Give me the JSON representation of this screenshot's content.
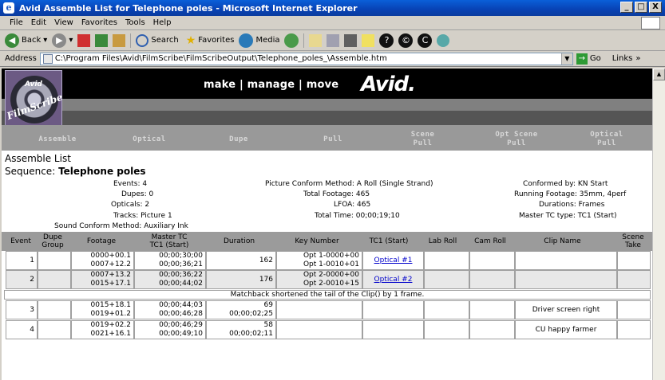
{
  "window": {
    "title": "Avid Assemble List for Telephone poles - Microsoft Internet Explorer",
    "minimize": "_",
    "restore": "□",
    "close": "X"
  },
  "menu": [
    "File",
    "Edit",
    "View",
    "Favorites",
    "Tools",
    "Help"
  ],
  "toolbar": {
    "back": "Back",
    "search": "Search",
    "favorites": "Favorites",
    "media": "Media"
  },
  "address": {
    "label": "Address",
    "url": "C:\\Program Files\\Avid\\FilmScribe\\FilmScribeOutput\\Telephone_poles_\\Assemble.htm",
    "go": "Go",
    "links": "Links"
  },
  "banner": {
    "nav": "make | manage | move",
    "brand": "Avid.",
    "logo_small": "Avid",
    "logo_name": "FilmScribe"
  },
  "tabs": [
    {
      "l1": "Assemble",
      "l2": ""
    },
    {
      "l1": "Optical",
      "l2": ""
    },
    {
      "l1": "Dupe",
      "l2": ""
    },
    {
      "l1": "Pull",
      "l2": ""
    },
    {
      "l1": "Scene",
      "l2": "Pull"
    },
    {
      "l1": "Opt Scene",
      "l2": "Pull"
    },
    {
      "l1": "Optical",
      "l2": "Pull"
    }
  ],
  "page": {
    "heading": "Assemble List",
    "sequence_label": "Sequence:",
    "sequence_name": "Telephone poles"
  },
  "info": {
    "events": "Events: 4",
    "dupes": "Dupes: 0",
    "opticals": "Opticals: 2",
    "tracks": "Tracks: Picture 1",
    "sound_conform": "Sound Conform Method: Auxiliary Ink",
    "picture_conform": "Picture Conform Method: A Roll (Single Strand)",
    "total_footage": "Total Footage: 465",
    "lfoa": "LFOA: 465",
    "total_time": "Total Time: 00;00;19;10",
    "conformed_by": "Conformed by: KN Start",
    "running_footage": "Running Footage: 35mm, 4perf",
    "durations": "Durations: Frames",
    "master_tc_type": "Master TC type: TC1 (Start)"
  },
  "table": {
    "headers": {
      "event": "Event",
      "dupe_group": "Dupe\nGroup",
      "footage": "Footage",
      "master_tc": "Master TC\nTC1 (Start)",
      "duration": "Duration",
      "key_number": "Key Number",
      "tc1": "TC1 (Start)",
      "lab_roll": "Lab Roll",
      "cam_roll": "Cam Roll",
      "clip_name": "Clip Name",
      "scene_take": "Scene\nTake"
    },
    "rows": [
      {
        "event": "1",
        "footage1": "0000+00.1",
        "footage2": "0007+12.2",
        "tc1": "00;00;30;00",
        "tc2": "00;00;36;21",
        "dur1": "162",
        "dur2": "",
        "key1": "Opt 1-0000+00",
        "key2": "Opt 1-0010+01",
        "link": "Optical #1",
        "clip": ""
      },
      {
        "event": "2",
        "footage1": "0007+13.2",
        "footage2": "0015+17.1",
        "tc1": "00;00;36;22",
        "tc2": "00;00;44;02",
        "dur1": "176",
        "dur2": "",
        "key1": "Opt 2-0000+00",
        "key2": "Opt 2-0010+15",
        "link": "Optical #2",
        "clip": ""
      },
      {
        "event": "3",
        "footage1": "0015+18.1",
        "footage2": "0019+01.2",
        "tc1": "00;00;44;03",
        "tc2": "00;00;46;28",
        "dur1": "69",
        "dur2": "00;00;02;25",
        "key1": "",
        "key2": "",
        "link": "",
        "clip": "Driver screen right"
      },
      {
        "event": "4",
        "footage1": "0019+02.2",
        "footage2": "0021+16.1",
        "tc1": "00;00;46;29",
        "tc2": "00;00;49;10",
        "dur1": "58",
        "dur2": "00;00;02;11",
        "key1": "",
        "key2": "",
        "link": "",
        "clip": "CU happy farmer"
      }
    ],
    "note": "Matchback shortened the tail of the Clip() by 1 frame."
  }
}
